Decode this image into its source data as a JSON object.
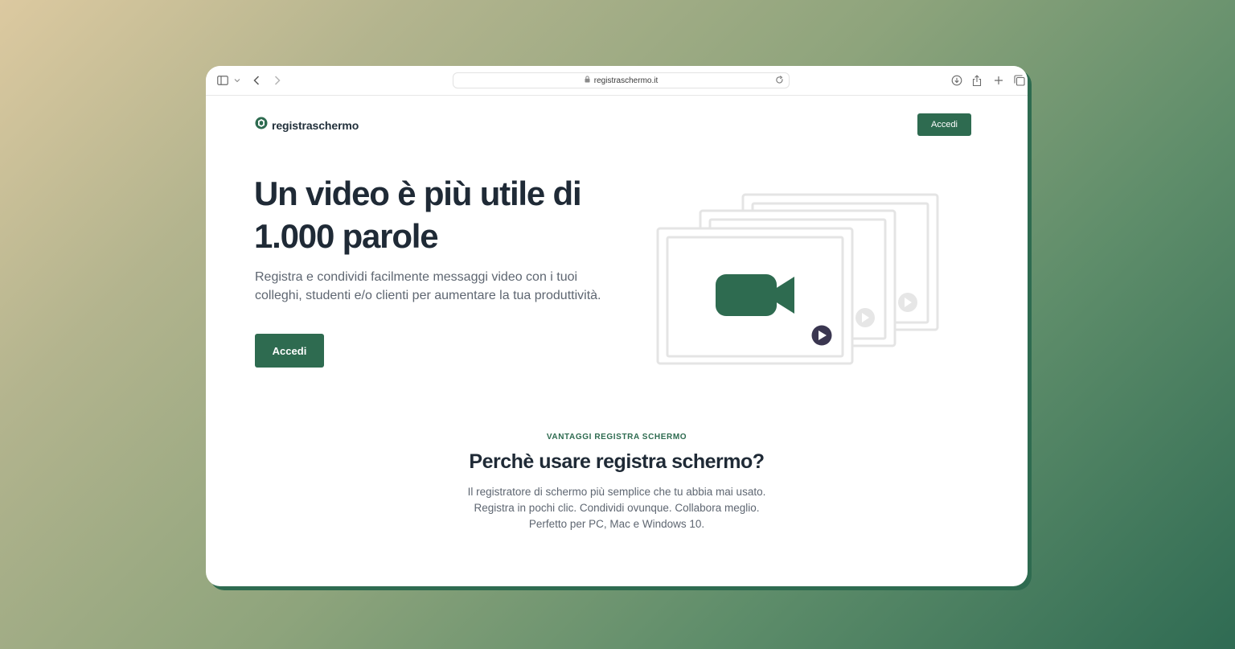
{
  "browser": {
    "url": "registraschermo.it"
  },
  "nav": {
    "logo_text": "registraschermo",
    "login_label": "Accedi"
  },
  "hero": {
    "title_line1": "Un video è più utile di",
    "title_line2": "1.000 parole",
    "subtitle": "Registra e condividi facilmente messaggi video con i tuoi colleghi, studenti e/o clienti per aumentare la tua produttività.",
    "cta_label": "Accedi"
  },
  "section": {
    "eyebrow": "VANTAGGI REGISTRA SCHERMO",
    "title": "Perchè usare registra schermo?",
    "desc_line1": "Il registratore di schermo più semplice che tu abbia mai usato.",
    "desc_line2": "Registra in pochi clic. Condividi ovunque. Collabora meglio.",
    "desc_line3": "Perfetto per PC, Mac e Windows 10."
  },
  "colors": {
    "brand": "#2e6b50",
    "heading": "#1f2a36",
    "text_muted": "#5e6671"
  },
  "icons": [
    "sidebar-icon",
    "chevron-down-icon",
    "back-icon",
    "forward-icon",
    "lock-icon",
    "reload-icon",
    "download-icon",
    "share-icon",
    "new-tab-icon",
    "tabs-overview-icon",
    "logo-icon",
    "video-camera-icon",
    "play-icon"
  ]
}
